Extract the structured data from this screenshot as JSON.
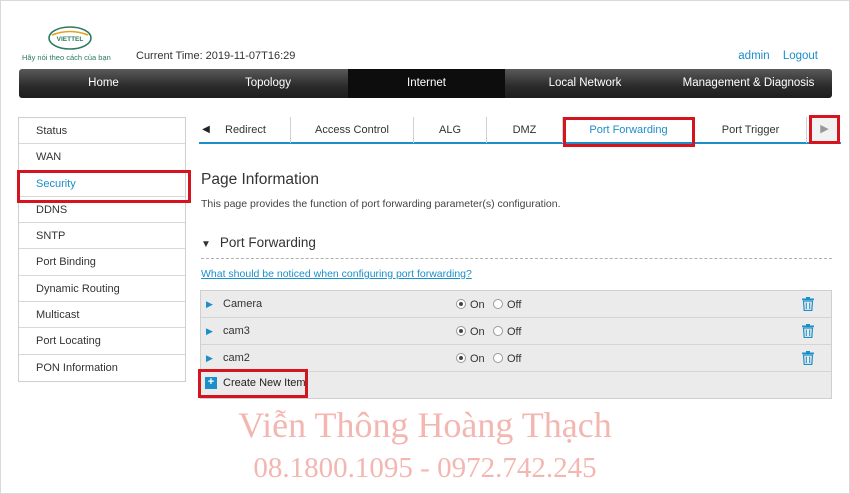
{
  "header": {
    "logo_text": "VIETTEL",
    "tagline": "Hãy nói theo cách của bạn",
    "current_time_label": "Current Time: 2019-11-07T16:29",
    "user": "admin",
    "logout": "Logout"
  },
  "main_nav": [
    {
      "label": "Home",
      "active": false
    },
    {
      "label": "Topology",
      "active": false
    },
    {
      "label": "Internet",
      "active": true
    },
    {
      "label": "Local Network",
      "active": false
    },
    {
      "label": "Management & Diagnosis",
      "active": false
    }
  ],
  "sidebar": {
    "items": [
      {
        "label": "Status"
      },
      {
        "label": "WAN"
      },
      {
        "label": "Security",
        "active": true
      },
      {
        "label": "DDNS"
      },
      {
        "label": "SNTP"
      },
      {
        "label": "Port Binding"
      },
      {
        "label": "Dynamic Routing"
      },
      {
        "label": "Multicast"
      },
      {
        "label": "Port Locating"
      },
      {
        "label": "PON Information"
      }
    ]
  },
  "tabs": [
    {
      "label": "Redirect"
    },
    {
      "label": "Access Control"
    },
    {
      "label": "ALG"
    },
    {
      "label": "DMZ"
    },
    {
      "label": "Port Forwarding",
      "active": true
    },
    {
      "label": "Port Trigger"
    }
  ],
  "content": {
    "page_title": "Page Information",
    "page_desc": "This page provides the function of port forwarding parameter(s) configuration.",
    "section_title": "Port Forwarding",
    "help_link": "What should be noticed when configuring port forwarding?",
    "on_label": "On",
    "off_label": "Off",
    "rules": [
      {
        "name": "Camera",
        "state": "On"
      },
      {
        "name": "cam3",
        "state": "On"
      },
      {
        "name": "cam2",
        "state": "On"
      }
    ],
    "create_label": "Create New Item"
  },
  "watermark": {
    "line1": "Viễn Thông Hoàng Thạch",
    "line2": "08.1800.1095 - 0972.742.245"
  },
  "colors": {
    "accent": "#1a8fc9",
    "highlight": "#d4151f",
    "brand_green": "#2b7a5e"
  },
  "icons": {
    "tab_left": "caret-left-icon",
    "tab_right": "caret-right-icon",
    "expand": "caret-right-icon",
    "delete": "trash-icon",
    "create": "plus-icon"
  }
}
